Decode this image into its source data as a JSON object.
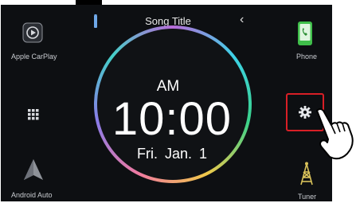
{
  "status_bar": {
    "song_title": "Song Title",
    "back_glyph": "‹"
  },
  "clock": {
    "ampm": "AM",
    "time": "10:00",
    "date": "Fri.  Jan.  1"
  },
  "left_column": [
    {
      "label": "Apple CarPlay",
      "icon": "carplay-icon"
    },
    {
      "label": "",
      "icon": "grid-menu-icon"
    },
    {
      "label": "Android Auto",
      "icon": "android-auto-icon"
    }
  ],
  "right_column": [
    {
      "label": "Phone",
      "icon": "phone-icon"
    },
    {
      "label": "",
      "icon": "gear-icon"
    },
    {
      "label": "Tuner",
      "icon": "tuner-antenna-icon"
    }
  ],
  "colors": {
    "screen_bg": "#0d0f12",
    "highlight": "#d81f26",
    "phone_green": "#3fbf4a"
  }
}
